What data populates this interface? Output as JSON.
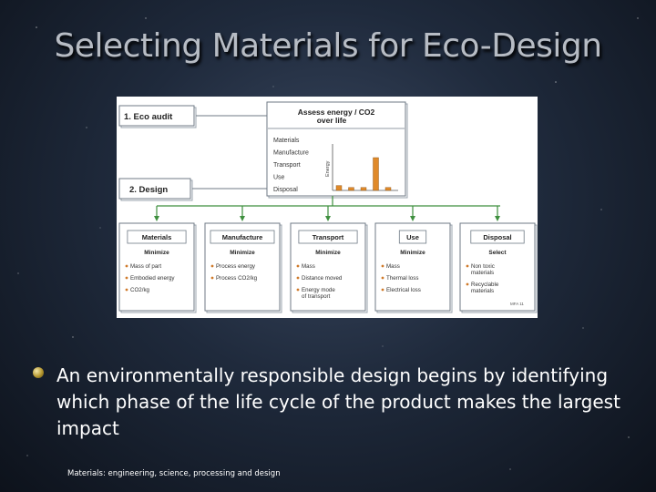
{
  "slide": {
    "title": "Selecting Materials for Eco-Design",
    "bullet": "An environmentally responsible design begins by identifying which phase of the life cycle of the product makes the largest impact",
    "footer": "Materials: engineering, science, processing and design",
    "colors": {
      "bullet_dot": "#c9a73a",
      "bar": "#e08a2a",
      "arrow": "#3e8f3e"
    }
  },
  "diagram": {
    "eco_audit_label": "1. Eco audit",
    "design_label": "2. Design",
    "assess_title_line1": "Assess energy / CO2",
    "assess_title_line2": "over life",
    "energy_axis_label": "Energy",
    "phase_labels": [
      "Materials",
      "Manufacture",
      "Transport",
      "Use",
      "Disposal"
    ],
    "chart_data": {
      "type": "bar",
      "categories": [
        "Materials",
        "Manufacture",
        "Transport",
        "Use",
        "Disposal"
      ],
      "values": [
        1,
        0.6,
        0.6,
        6.7,
        0.6
      ],
      "ylabel": "Energy"
    },
    "boxes": [
      {
        "header": "Materials",
        "sub": "Minimize",
        "items": [
          "Mass of part",
          "Embodied energy",
          "CO2/kg"
        ]
      },
      {
        "header": "Manufacture",
        "sub": "Minimize",
        "items": [
          "Process energy",
          "Process CO2/kg"
        ]
      },
      {
        "header": "Transport",
        "sub": "Minimize",
        "items": [
          "Mass",
          "Distance moved",
          "Energy mode of transport"
        ]
      },
      {
        "header": "Use",
        "sub": "Minimize",
        "items": [
          "Mass",
          "Thermal loss",
          "Electrical loss"
        ]
      },
      {
        "header": "Disposal",
        "sub": "Select",
        "items": [
          "Non toxic materials",
          "Recyclable materials"
        ]
      }
    ],
    "credit": "MFA 11"
  }
}
